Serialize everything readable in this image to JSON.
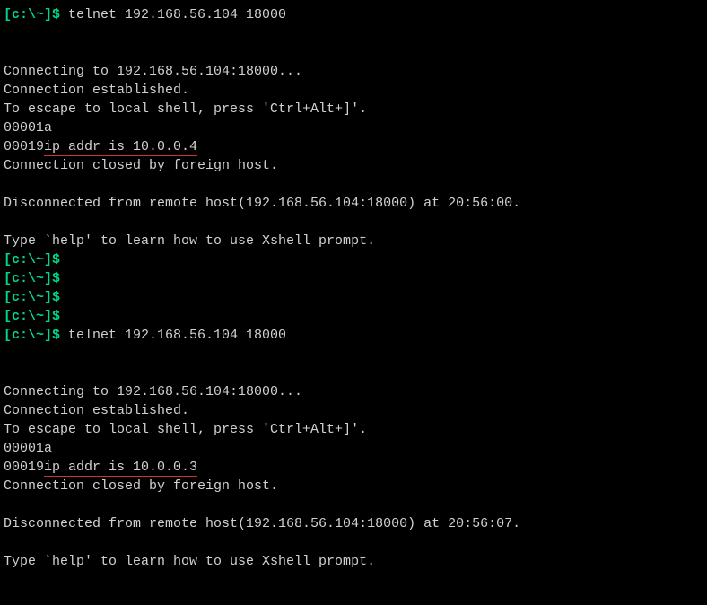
{
  "colors": {
    "bg": "#000000",
    "prompt": "#00d787",
    "text": "#d0d0d0",
    "underline": "#cc3333"
  },
  "block1": {
    "prompt": "[c:\\~]$ ",
    "cmd": "telnet 192.168.56.104 18000",
    "blank1": "",
    "blank2": "",
    "connecting": "Connecting to 192.168.56.104:18000...",
    "established": "Connection established.",
    "escape": "To escape to local shell, press 'Ctrl+Alt+]'.",
    "hex1": "00001a",
    "hex2_prefix": "00019",
    "hex2_underlined": "ip addr is 10.0.0.4",
    "closed": "Connection closed by foreign host.",
    "blank3": "",
    "disconnected": "Disconnected from remote host(192.168.56.104:18000) at 20:56:00.",
    "blank4": "",
    "help": "Type `help' to learn how to use Xshell prompt."
  },
  "empty_prompts": {
    "p1": "[c:\\~]$",
    "p2": "[c:\\~]$",
    "p3": "[c:\\~]$",
    "p4": "[c:\\~]$"
  },
  "block2": {
    "prompt": "[c:\\~]$ ",
    "cmd": "telnet 192.168.56.104 18000",
    "blank1": "",
    "blank2": "",
    "connecting": "Connecting to 192.168.56.104:18000...",
    "established": "Connection established.",
    "escape": "To escape to local shell, press 'Ctrl+Alt+]'.",
    "hex1": "00001a",
    "hex2_prefix": "00019",
    "hex2_underlined": "ip addr is 10.0.0.3",
    "closed": "Connection closed by foreign host.",
    "blank3": "",
    "disconnected": "Disconnected from remote host(192.168.56.104:18000) at 20:56:07.",
    "blank4": "",
    "help": "Type `help' to learn how to use Xshell prompt."
  }
}
